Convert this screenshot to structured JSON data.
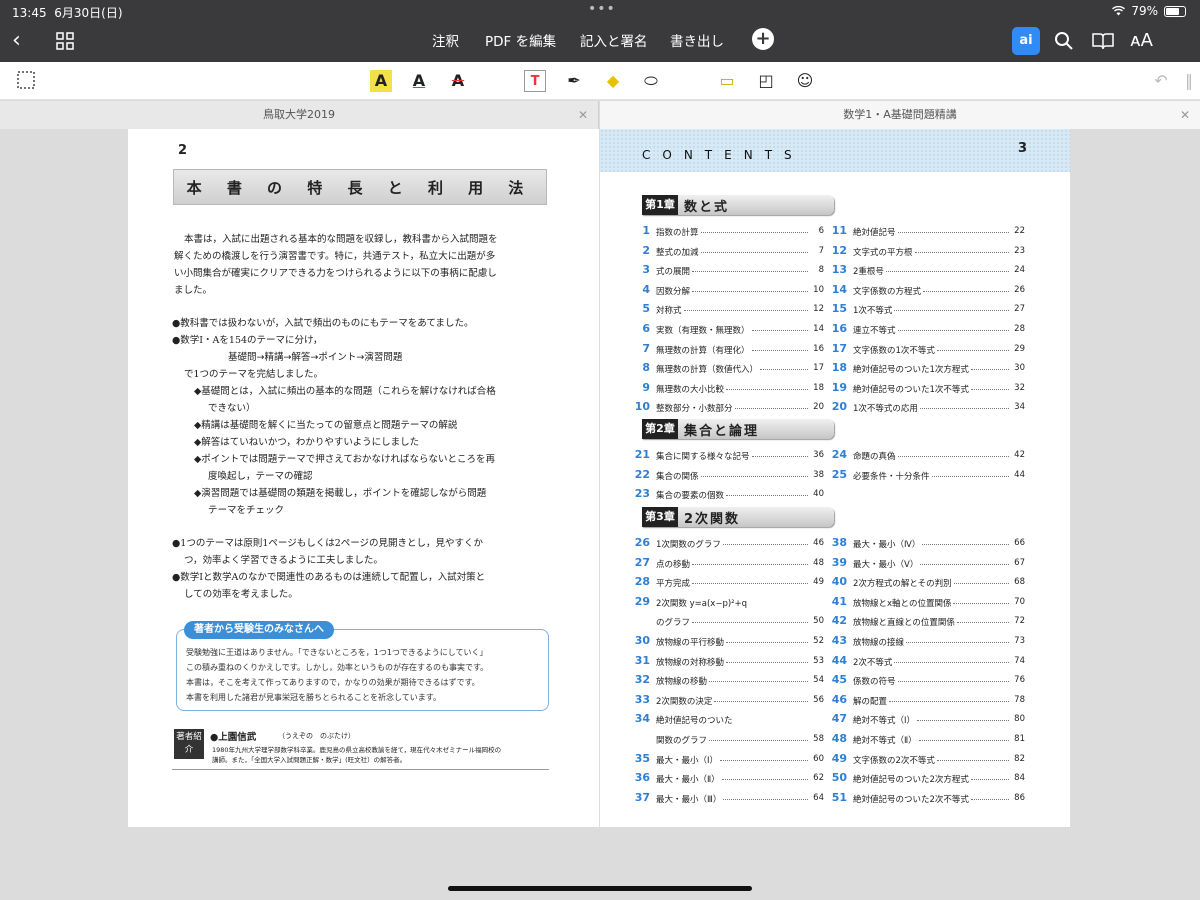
{
  "status": {
    "time": "13:45",
    "date": "6月30日(日)",
    "battery": "79%"
  },
  "nav": {
    "annotate": "注釈",
    "edit_pdf": "PDF を編集",
    "fill_sign": "記入と署名",
    "export": "書き出し",
    "ai_label": "ai"
  },
  "tabs": {
    "left": "鳥取大学2019",
    "right": "数学1・A基礎問題精講"
  },
  "left": {
    "page_number": "2",
    "title": "本 書 の 特 長 と 利 用 法",
    "intro": [
      "本書は，入試に出題される基本的な問題を収録し，教科書から入試問題を",
      "解くための橋渡しを行う演習書です。特に，共通テスト，私立大に出題が多",
      "い小問集合が確実にクリアできる力をつけられるように以下の事柄に配慮し",
      "ました。"
    ],
    "b1": "●教科書では扱わないが，入試で頻出のものにもテーマをあてました。",
    "b2": "●数学Ⅰ・Aを154のテーマに分け，",
    "flow": "基礎問→精講→解答→ポイント→演習問題",
    "b2b": "で1つのテーマを完結しました。",
    "d1a": "◆基礎問とは，入試に頻出の基本的な問題（これらを解けなければ合格",
    "d1b": "できない）",
    "d2": "◆精講は基礎問を解くに当たっての留意点と問題テーマの解説",
    "d3": "◆解答はていねいかつ，わかりやすいようにしました",
    "d4a": "◆ポイントでは問題テーマで押さえておかなければならないところを再",
    "d4b": "度喚起し，テーマの確認",
    "d5a": "◆演習問題では基礎問の類題を掲載し，ポイントを確認しながら問題",
    "d5b": "テーマをチェック",
    "b3a": "●1つのテーマは原則1ページもしくは2ページの見開きとし，見やすくか",
    "b3b": "つ，効率よく学習できるように工夫しました。",
    "b4a": "●数学Ⅰと数学Aのなかで関連性のあるものは連続して配置し，入試対策と",
    "b4b": "しての効率を考えました。",
    "msg_title": "著者から受験生のみなさんへ",
    "msg": [
      "受験勉強に王道はありません。「できないところを，1つ1つできるようにしていく」",
      "この積み重ねのくりかえしです。しかし，効率というものが存在するのも事実です。",
      "本書は，そこを考えて作ってありますので，かなりの効果が期待できるはずです。",
      "本書を利用した諸君が見事栄冠を勝ちとられることを祈念しています。"
    ],
    "author_badge": "著者紹介",
    "author_name": "●上園信武",
    "author_kana": "（うえぞの　のぶたけ）",
    "author_bio": [
      "1980年九州大学理学部数学科卒業。鹿児島の県立高校教諭を経て，現在代々木ゼミナール福岡校の",
      "講師。また，「全国大学入試問題正解・数学」(旺文社）の解答者。"
    ]
  },
  "right": {
    "page_number": "3",
    "contents_title": "CONTENTS",
    "chapters": [
      {
        "tag": "第1章",
        "title": "数と式"
      },
      {
        "tag": "第2章",
        "title": "集合と論理"
      },
      {
        "tag": "第3章",
        "title": "2次関数"
      }
    ],
    "col1": [
      [
        "1",
        "指数の計算",
        "6"
      ],
      [
        "2",
        "整式の加減",
        "7"
      ],
      [
        "3",
        "式の展開",
        "8"
      ],
      [
        "4",
        "因数分解",
        "10"
      ],
      [
        "5",
        "対称式",
        "12"
      ],
      [
        "6",
        "実数（有理数・無理数）",
        "14"
      ],
      [
        "7",
        "無理数の計算（有理化）",
        "16"
      ],
      [
        "8",
        "無理数の計算（数値代入）",
        "17"
      ],
      [
        "9",
        "無理数の大小比較",
        "18"
      ],
      [
        "10",
        "整数部分・小数部分",
        "20"
      ],
      [
        "21",
        "集合に関する様々な記号",
        "36"
      ],
      [
        "22",
        "集合の関係",
        "38"
      ],
      [
        "23",
        "集合の要素の個数",
        "40"
      ],
      [
        "26",
        "1次関数のグラフ",
        "46"
      ],
      [
        "27",
        "点の移動",
        "48"
      ],
      [
        "28",
        "平方完成",
        "49"
      ],
      [
        "29",
        "2次関数 y=a(x−p)²+q",
        ""
      ],
      [
        "",
        "のグラフ",
        "50"
      ],
      [
        "30",
        "放物線の平行移動",
        "52"
      ],
      [
        "31",
        "放物線の対称移動",
        "53"
      ],
      [
        "32",
        "放物線の移動",
        "54"
      ],
      [
        "33",
        "2次関数の決定",
        "56"
      ],
      [
        "34",
        "絶対値記号のついた",
        ""
      ],
      [
        "",
        "関数のグラフ",
        "58"
      ],
      [
        "35",
        "最大・最小（Ⅰ）",
        "60"
      ],
      [
        "36",
        "最大・最小（Ⅱ）",
        "62"
      ],
      [
        "37",
        "最大・最小（Ⅲ）",
        "64"
      ]
    ],
    "col2": [
      [
        "11",
        "絶対値記号",
        "22"
      ],
      [
        "12",
        "文字式の平方根",
        "23"
      ],
      [
        "13",
        "2重根号",
        "24"
      ],
      [
        "14",
        "文字係数の方程式",
        "26"
      ],
      [
        "15",
        "1次不等式",
        "27"
      ],
      [
        "16",
        "連立不等式",
        "28"
      ],
      [
        "17",
        "文字係数の1次不等式",
        "29"
      ],
      [
        "18",
        "絶対値記号のついた1次方程式",
        "30"
      ],
      [
        "19",
        "絶対値記号のついた1次不等式",
        "32"
      ],
      [
        "20",
        "1次不等式の応用",
        "34"
      ],
      [
        "24",
        "命題の真偽",
        "42"
      ],
      [
        "25",
        "必要条件・十分条件",
        "44"
      ],
      [
        "38",
        "最大・最小（Ⅳ）",
        "66"
      ],
      [
        "39",
        "最大・最小（Ⅴ）",
        "67"
      ],
      [
        "40",
        "2次方程式の解とその判別",
        "68"
      ],
      [
        "41",
        "放物線とx軸との位置関係",
        "70"
      ],
      [
        "42",
        "放物線と直線との位置関係",
        "72"
      ],
      [
        "43",
        "放物線の接線",
        "73"
      ],
      [
        "44",
        "2次不等式",
        "74"
      ],
      [
        "45",
        "係数の符号",
        "76"
      ],
      [
        "46",
        "解の配置",
        "78"
      ],
      [
        "47",
        "絶対不等式（Ⅰ）",
        "80"
      ],
      [
        "48",
        "絶対不等式（Ⅱ）",
        "81"
      ],
      [
        "49",
        "文字係数の2次不等式",
        "82"
      ],
      [
        "50",
        "絶対値記号のついた2次方程式",
        "84"
      ],
      [
        "51",
        "絶対値記号のついた2次不等式",
        "86"
      ]
    ]
  },
  "colors": {
    "accent": "#2f7fd4",
    "toolbar_bg": "#3a3a3c",
    "ai_button": "#2f8bf5"
  }
}
